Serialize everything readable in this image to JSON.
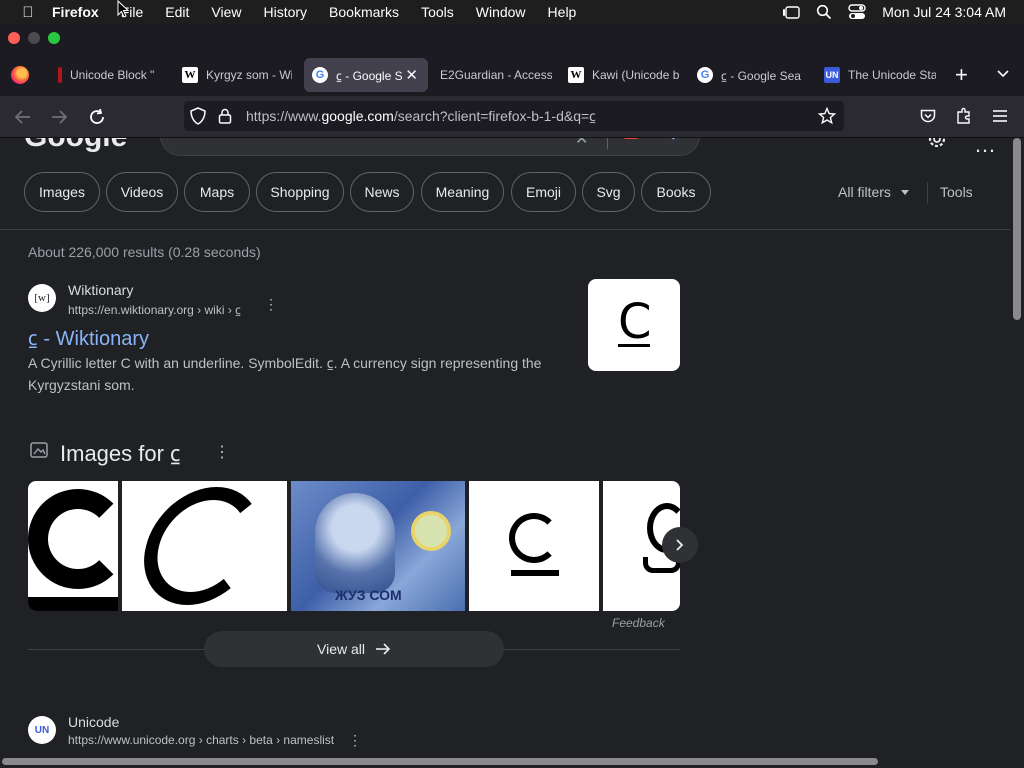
{
  "menubar": {
    "app_name": "Firefox",
    "items": [
      "File",
      "Edit",
      "View",
      "History",
      "Bookmarks",
      "Tools",
      "Window",
      "Help"
    ],
    "clock": "Mon Jul 24  3:04 AM"
  },
  "tabs": [
    {
      "title": "Unicode Block \"",
      "favicon": "red-bar-icon"
    },
    {
      "title": "Kyrgyz som - Wi",
      "favicon": "wikipedia-icon"
    },
    {
      "title": "⃀ - Google S",
      "favicon": "google-icon",
      "active": true
    },
    {
      "title": "E2Guardian - Access",
      "favicon": "none"
    },
    {
      "title": "Kawi (Unicode b",
      "favicon": "wikipedia-icon"
    },
    {
      "title": "⃀ - Google Sea",
      "favicon": "google-icon"
    },
    {
      "title": "The Unicode Sta",
      "favicon": "unicode-icon"
    }
  ],
  "url": {
    "prefix": "https://www.",
    "domain": "google.com",
    "path": "/search?client=firefox-b-1-d&q=⃀"
  },
  "google": {
    "logo": "Google",
    "filters": [
      "Images",
      "Videos",
      "Maps",
      "Shopping",
      "News",
      "Meaning",
      "Emoji",
      "Svg",
      "Books"
    ],
    "all_filters": "All filters",
    "tools": "Tools",
    "result_stats": "About 226,000 results (0.28 seconds)"
  },
  "result1": {
    "site_name": "Wiktionary",
    "site_icon": "[w]",
    "breadcrumb": "https://en.wiktionary.org › wiki › ⃀",
    "title": "⃀ - Wiktionary",
    "snippet": "A Cyrillic letter C with an underline. SymbolEdit. ⃀. A currency sign representing the Kyrgyzstani som.",
    "thumb_glyph": "C"
  },
  "images_section": {
    "heading": "Images for ⃀",
    "banknote_text": "ЖУЗ СОМ",
    "feedback": "Feedback",
    "view_all": "View all"
  },
  "result2": {
    "site_name": "Unicode",
    "site_icon": "UN",
    "breadcrumb": "https://www.unicode.org › charts › beta › nameslist"
  },
  "colors": {
    "link": "#8ab4f8",
    "background": "#202124",
    "chrome": "#2b2a33",
    "close": "#ff5f57",
    "minimize": "#febc2e",
    "zoom": "#28c840"
  }
}
